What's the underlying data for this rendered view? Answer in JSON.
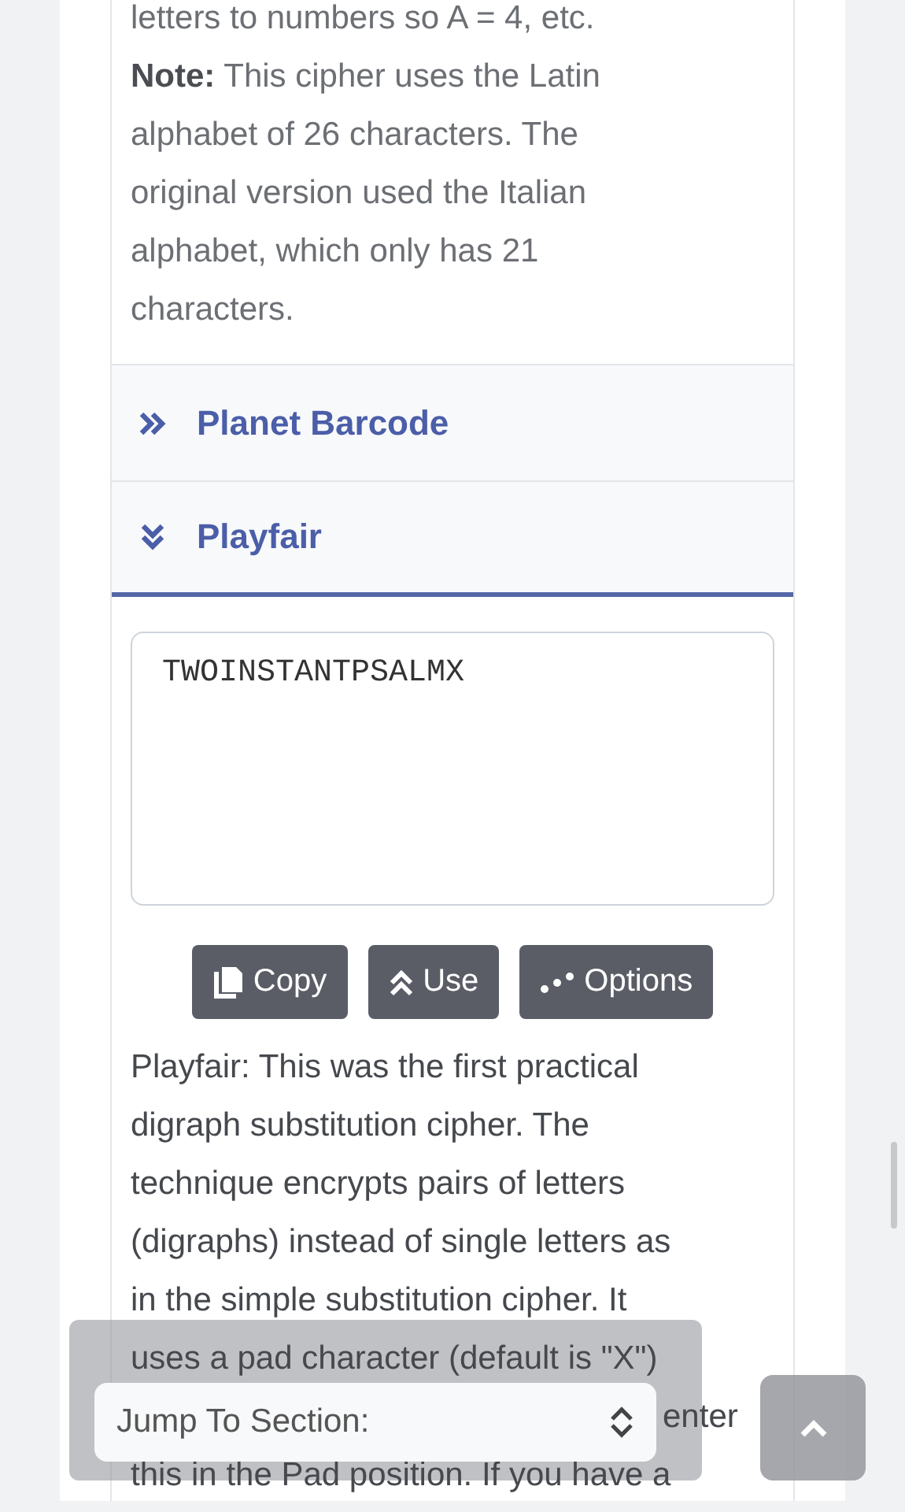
{
  "intro": {
    "first_line": "letters to numbers so A = 4, etc.",
    "note": "**Note:** This cipher uses the Latin alphabet of 26 characters. The original version used the Italian alphabet, which only has 21 characters."
  },
  "sections": [
    {
      "title": "Planet Barcode",
      "expanded": false
    },
    {
      "title": "Playfair",
      "expanded": true
    }
  ],
  "output": {
    "value": "TWOINSTANTPSALMX"
  },
  "buttons": [
    {
      "label": "Copy",
      "kind": "copy"
    },
    {
      "label": "Use",
      "kind": "use"
    },
    {
      "label": "Options",
      "kind": "options"
    }
  ],
  "description": {
    "lines": [
      "Playfair: This was the first practical",
      "digraph substitution cipher. The",
      "technique encrypts pairs of letters",
      "(digraphs) instead of single letters as",
      "in the simple substitution cipher. It",
      "uses a pad character (default is \"X\")"
    ],
    "partial": "enter",
    "last_line": "this in the Pad position. If you have a"
  },
  "jump": {
    "label": "Jump To Section:"
  }
}
